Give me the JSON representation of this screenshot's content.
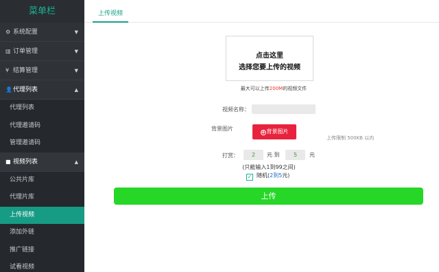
{
  "sidebar": {
    "title": "菜单栏",
    "groups": [
      {
        "label": "系统配置",
        "icon": "gear-icon",
        "glyph": "⚙",
        "caret": "▼"
      },
      {
        "label": "订单管理",
        "icon": "bar-chart-icon",
        "glyph": "▥",
        "caret": "▼"
      },
      {
        "label": "结算管理",
        "icon": "yen-icon",
        "glyph": "¥",
        "caret": "▼"
      },
      {
        "label": "代理列表",
        "icon": "user-icon",
        "glyph": "👤",
        "caret": "▲",
        "items": [
          "代理列表",
          "代理邀请码",
          "管理邀请码"
        ]
      },
      {
        "label": "视频列表",
        "icon": "video-camera-icon",
        "glyph": "■",
        "caret": "▲",
        "items": [
          "公共片库",
          "代理片库",
          "上传视频",
          "添加外链",
          "推广链接",
          "试看视频"
        ]
      }
    ],
    "active_item": "上传视频"
  },
  "tabs": {
    "active": "上传视频"
  },
  "upload": {
    "line1": "点击这里",
    "line2": "选择您要上传的视频",
    "hint_prefix": "最大可以上传",
    "hint_size": "200M",
    "hint_suffix": "的视频文件"
  },
  "form": {
    "name_label": "视频名称：",
    "name_value": "",
    "bg_label": "背景图片",
    "bg_button": "背景图片",
    "bg_button_glyph": "+",
    "bg_limit": "上传限制 500KB 以内",
    "reward_label": "打赏：",
    "reward_min": "2",
    "reward_min_unit": "元 到",
    "reward_max": "5",
    "reward_max_unit": "元",
    "range_hint": "(只能输入1到99之间)",
    "random_checked": true,
    "random_check_glyph": "✓",
    "random_prefix": "随机(",
    "random_range": "2到5",
    "random_suffix": "元)",
    "submit": "上传"
  },
  "colors": {
    "sidebar_bg": "#2f3338",
    "accent": "#16a085",
    "active_item": "#169b84",
    "bg_button": "#e8233d",
    "submit": "#27d727",
    "highlight_red": "#e4322b"
  }
}
